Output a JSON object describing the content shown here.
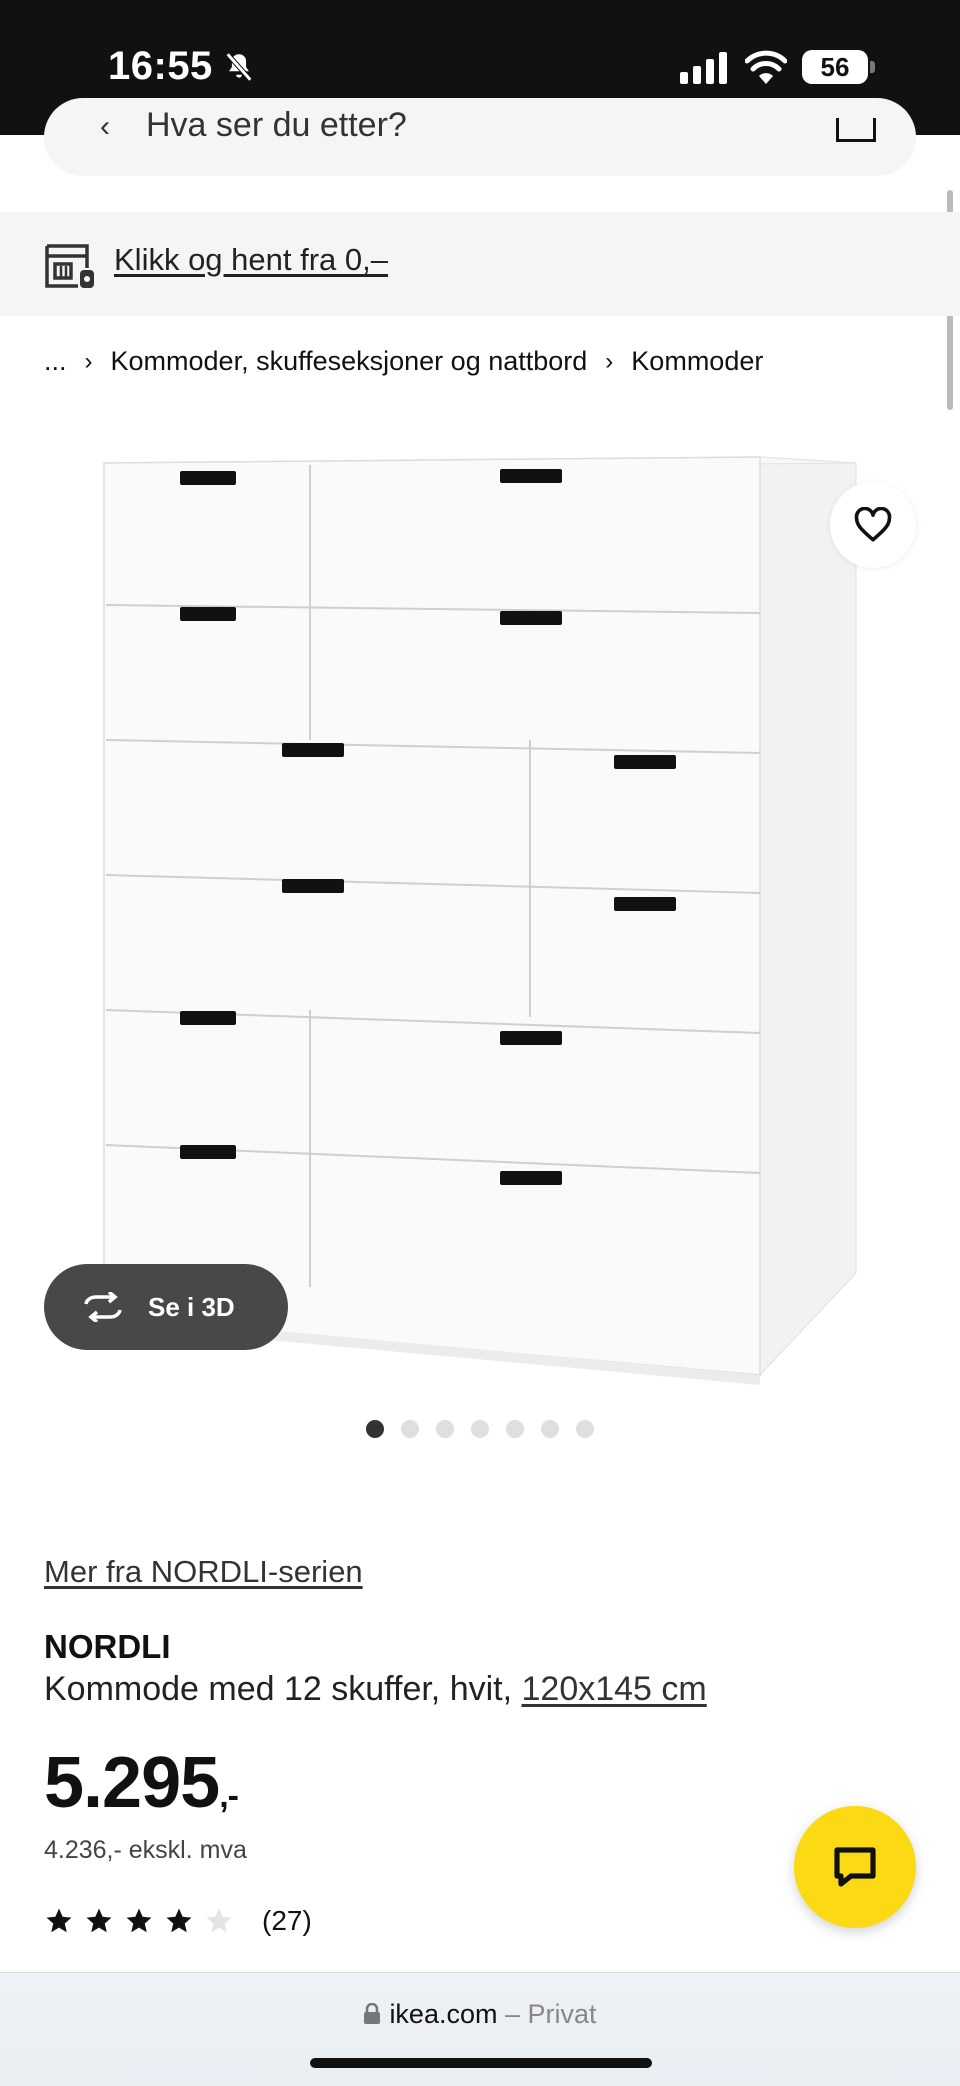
{
  "status_bar": {
    "time": "16:55",
    "battery": "56"
  },
  "search": {
    "placeholder": "Hva ser du etter?"
  },
  "pickup": {
    "label": "Klikk og hent fra 0,–"
  },
  "breadcrumb": {
    "ellipsis": "...",
    "items": [
      "Kommoder, skuffeseksjoner og nattbord",
      "Kommoder"
    ]
  },
  "image": {
    "view3d_label": "Se i 3D",
    "carousel_count": 7,
    "carousel_active": 1
  },
  "product": {
    "series_link": "Mer fra NORDLI-serien",
    "name": "NORDLI",
    "description": "Kommode med 12 skuffer, hvit,",
    "size": "120x145 cm",
    "price": "5.295",
    "price_suffix": ",-",
    "price_ex_vat": "4.236,- ekskl. mva",
    "rating_stars": 4,
    "rating_max": 5,
    "review_count": "(27)"
  },
  "browser": {
    "domain": "ikea.com",
    "separator": " – ",
    "mode": "Privat"
  },
  "colors": {
    "accent_yellow": "#fbd914",
    "dark_button": "#484848"
  }
}
